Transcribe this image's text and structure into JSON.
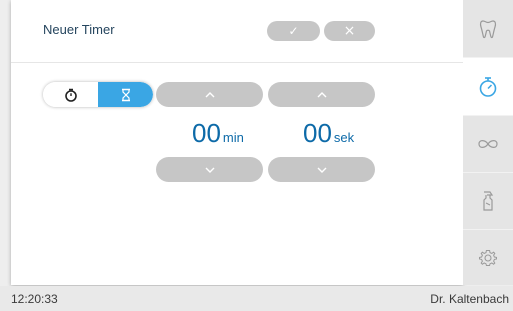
{
  "dialog": {
    "title": "Neuer Timer",
    "confirm_label": "✓",
    "cancel_label": "×"
  },
  "mode_toggle": {
    "options": [
      {
        "name": "stopwatch",
        "icon": "stopwatch-icon",
        "active": false
      },
      {
        "name": "countdown",
        "icon": "hourglass-icon",
        "active": true
      }
    ]
  },
  "timer": {
    "minutes": {
      "value": "00",
      "unit": "min"
    },
    "seconds": {
      "value": "00",
      "unit": "sek"
    }
  },
  "sidebar": {
    "items": [
      {
        "icon": "tooth-icon",
        "active": false
      },
      {
        "icon": "timer-icon",
        "active": true
      },
      {
        "icon": "infinity-icon",
        "active": false
      },
      {
        "icon": "spray-bottle-icon",
        "active": false
      },
      {
        "icon": "settings-gear-icon",
        "active": false
      }
    ]
  },
  "status_bar": {
    "time": "12:20:33",
    "brand": "Dr. Kaltenbach"
  },
  "colors": {
    "accent": "#3aa6e4",
    "value_text": "#0d6aa8",
    "title_text": "#25455e",
    "button_grey": "#c6c6c6",
    "icon_grey": "#9a9a9a"
  }
}
